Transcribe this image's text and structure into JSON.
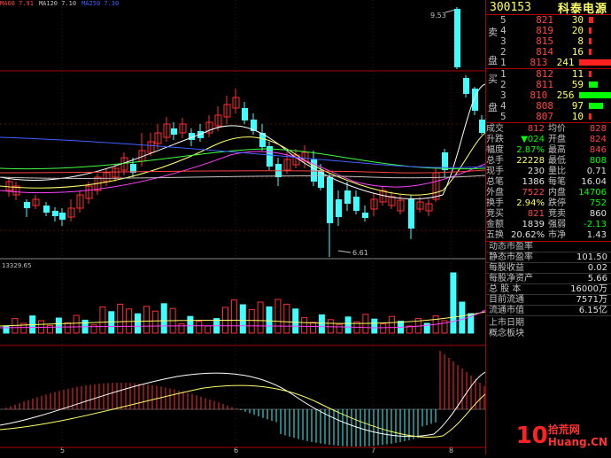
{
  "ma_legend": [
    {
      "text": "MA60 7.91",
      "color": "#ff4444"
    },
    {
      "text": "MA120 7.10",
      "color": "#c0c0c0"
    },
    {
      "text": "MA250 7.30",
      "color": "#4060ff"
    }
  ],
  "price_high_label": "9.53",
  "price_low_label": "6.61",
  "volume_label": "13329.65",
  "date_ticks": [
    "5",
    "6",
    "7",
    "8"
  ],
  "header": {
    "code": "300153",
    "name": "科泰电源"
  },
  "sell": {
    "label": "卖盘",
    "rows": [
      {
        "level": "5",
        "price": "821",
        "volume": "30"
      },
      {
        "level": "4",
        "price": "819",
        "volume": "20"
      },
      {
        "level": "3",
        "price": "815",
        "volume": "8"
      },
      {
        "level": "2",
        "price": "814",
        "volume": "16"
      },
      {
        "level": "1",
        "price": "813",
        "volume": "241"
      }
    ]
  },
  "buy": {
    "label": "买盘",
    "rows": [
      {
        "level": "1",
        "price": "812",
        "volume": "11"
      },
      {
        "level": "2",
        "price": "811",
        "volume": "59"
      },
      {
        "level": "3",
        "price": "810",
        "volume": "256"
      },
      {
        "level": "4",
        "price": "808",
        "volume": "97"
      },
      {
        "level": "5",
        "price": "807",
        "volume": "10"
      }
    ]
  },
  "stats": [
    {
      "k1": "成交",
      "v1": "812",
      "c1": "red",
      "k2": "均价",
      "v2": "828",
      "c2": "red"
    },
    {
      "k1": "升跌",
      "v1": "▼024",
      "c1": "grn",
      "k2": "开盘",
      "v2": "824",
      "c2": "red"
    },
    {
      "k1": "幅度",
      "v1": "2.87%",
      "c1": "grn",
      "k2": "最高",
      "v2": "846",
      "c2": "red"
    },
    {
      "k1": "总手",
      "v1": "22228",
      "c1": "yel",
      "k2": "最低",
      "v2": "808",
      "c2": "grn"
    },
    {
      "k1": "现手",
      "v1": "230",
      "c1": "wht",
      "k2": "量比",
      "v2": "0.71",
      "c2": "wht"
    },
    {
      "k1": "总笔",
      "v1": "1386",
      "c1": "wht",
      "k2": "每笔",
      "v2": "16.04",
      "c2": "wht"
    },
    {
      "k1": "外盘",
      "v1": "7522",
      "c1": "red",
      "k2": "内盘",
      "v2": "14706",
      "c2": "grn"
    },
    {
      "k1": "换手",
      "v1": "2.94%",
      "c1": "yel",
      "k2": "跌停",
      "v2": "752",
      "c2": "grn"
    },
    {
      "k1": "竞买",
      "v1": "821",
      "c1": "red",
      "k2": "竞卖",
      "v2": "860",
      "c2": "wht"
    },
    {
      "k1": "金额",
      "v1": "1839",
      "c1": "wht",
      "k2": "强弱",
      "v2": "-2.13",
      "c2": "grn"
    },
    {
      "k1": "五换",
      "v1": "20.62%",
      "c1": "wht",
      "k2": "市净",
      "v2": "1.43",
      "c2": "wht"
    }
  ],
  "fundamentals": [
    {
      "k": "动态市盈率",
      "v": ""
    },
    {
      "k": "静态市盈率",
      "v": "101.50"
    },
    {
      "k": "每股收益",
      "v": "0.02"
    },
    {
      "k": "每股净资产",
      "v": "5.66"
    },
    {
      "k": "总 股 本",
      "v": "16000万"
    },
    {
      "k": "目前流通",
      "v": "7571万"
    },
    {
      "k": "流通市值",
      "v": "6.15亿"
    }
  ],
  "extra": [
    "上市日期",
    "概念板块"
  ],
  "logo": {
    "number": "10",
    "line1": "拾荒网",
    "line2": "Huang.CN"
  },
  "colors": {
    "up": "#ff3030",
    "down": "#40ffff",
    "grid": "#aa0000"
  }
}
